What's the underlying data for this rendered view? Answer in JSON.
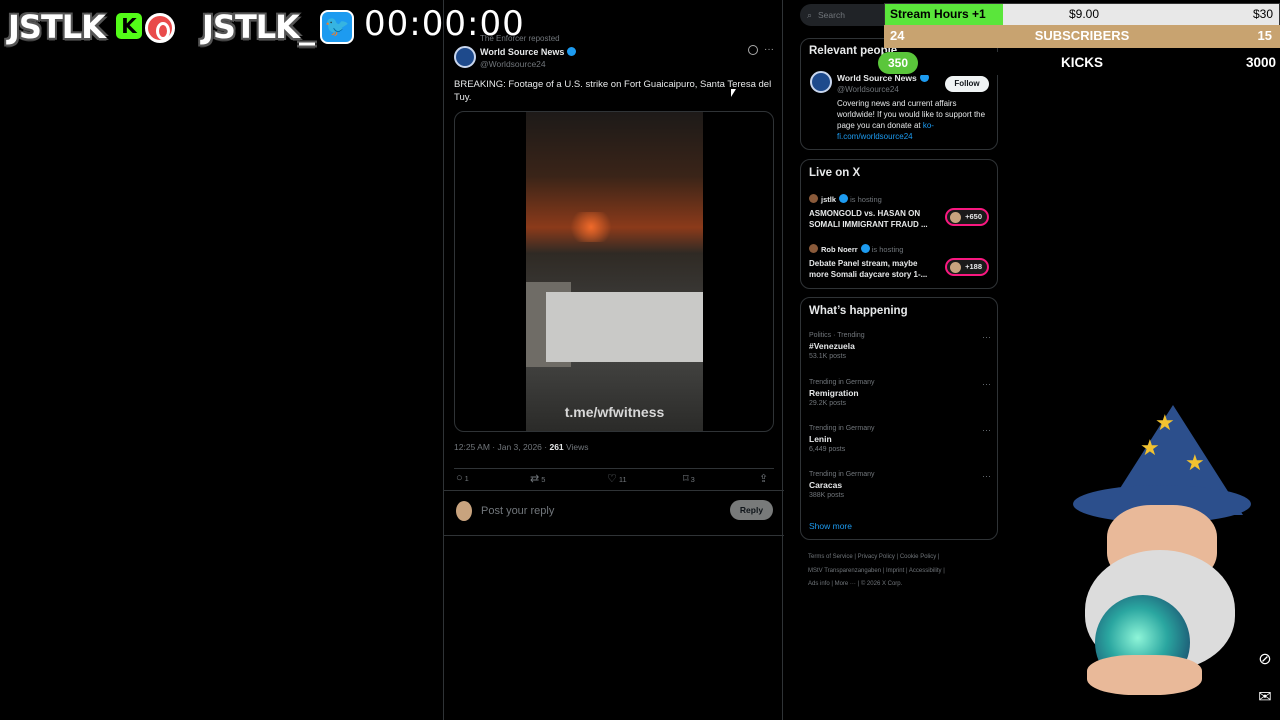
{
  "overlay": {
    "logo_left": "JSTLK",
    "kick_badge": "K",
    "logo_right": "JSTLK_",
    "twitter_badge": "🐦",
    "timer": "00:00:00",
    "goals": {
      "stream_hours_label": "Stream Hours +1",
      "stream_hours_progress": 0.3,
      "stream_hours_current": "$9.00",
      "stream_hours_target": "$30",
      "subscribers_current": "24",
      "subscribers_label": "SUBSCRIBERS",
      "subscribers_target": "15",
      "kicks_current": "350",
      "kicks_label": "KICKS",
      "kicks_target": "3000"
    }
  },
  "tweet": {
    "reposted_by": "The Enforcer reposted",
    "author_name": "World Source News",
    "author_handle": "@Worldsource24",
    "text": "BREAKING: Footage of a U.S. strike on Fort Guaicaipuro, Santa Teresa del Tuy.",
    "video_watermark": "t.me/wfwitness",
    "timestamp": "12:25 AM · Jan 3, 2026 ·",
    "views_count": "261",
    "views_label": "Views",
    "actions": {
      "replies": "1",
      "reposts": "5",
      "likes": "11",
      "bookmarks": "3"
    },
    "reply_placeholder": "Post your reply",
    "reply_button": "Reply"
  },
  "sidebar": {
    "search_placeholder": "Search",
    "relevant_people": {
      "title": "Relevant people",
      "name": "World Source News",
      "handle": "@Worldsource24",
      "follow_label": "Follow",
      "bio": "Covering news and current affairs worldwide! If you would like to support the page you can donate at",
      "bio_link": "ko-fi.com/worldsource24"
    },
    "live": {
      "title": "Live on X",
      "items": [
        {
          "host": "jstlk",
          "status": "is hosting",
          "title": "ASMONGOLD vs. HASAN ON SOMALI IMMIGRANT FRAUD ...",
          "count": "+650"
        },
        {
          "host": "Rob Noerr",
          "status": "is hosting",
          "title": "Debate Panel stream, maybe more Somali daycare story 1-...",
          "count": "+188"
        }
      ]
    },
    "happening": {
      "title": "What’s happening",
      "trends": [
        {
          "category": "Politics · Trending",
          "name": "#Venezuela",
          "count": "53.1K posts"
        },
        {
          "category": "Trending in Germany",
          "name": "Remigration",
          "count": "29.2K posts"
        },
        {
          "category": "Trending in Germany",
          "name": "Lenin",
          "count": "6,449 posts"
        },
        {
          "category": "Trending in Germany",
          "name": "Caracas",
          "count": "388K posts"
        }
      ],
      "show_more": "Show more"
    },
    "footer": {
      "links": [
        "Terms of Service",
        "Privacy Policy",
        "Cookie Policy",
        "MStV Transparenzangaben",
        "Imprint",
        "Accessibility",
        "Ads info",
        "More ···"
      ],
      "copyright": "© 2026 X Corp."
    }
  }
}
